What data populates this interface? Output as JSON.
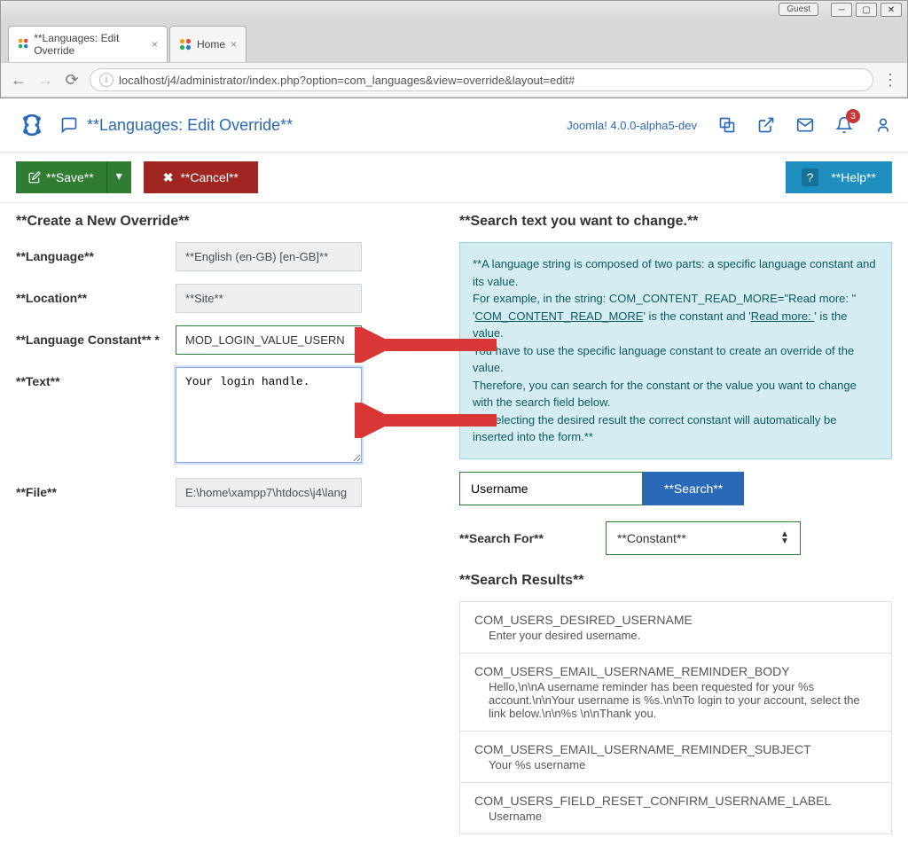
{
  "browser": {
    "guest": "Guest",
    "tabs": [
      {
        "title": "**Languages: Edit Override",
        "active": true
      },
      {
        "title": "Home",
        "active": false
      }
    ],
    "url": "localhost/j4/administrator/index.php?option=com_languages&view=override&layout=edit#"
  },
  "header": {
    "title": "**Languages: Edit Override**",
    "version": "Joomla! 4.0.0-alpha5-dev",
    "notification_count": "3"
  },
  "toolbar": {
    "save": "**Save**",
    "cancel": "**Cancel**",
    "help": "**Help**"
  },
  "form": {
    "heading": "**Create a New Override**",
    "language_label": "**Language**",
    "language_value": "**English (en-GB) [en-GB]**",
    "location_label": "**Location**",
    "location_value": "**Site**",
    "constant_label": "**Language Constant** *",
    "constant_value": "MOD_LOGIN_VALUE_USERN",
    "text_label": "**Text**",
    "text_value": "Your login handle.",
    "file_label": "**File**",
    "file_value": "E:\\home\\xampp7\\htdocs\\j4\\lang"
  },
  "search": {
    "heading": "**Search text you want to change.**",
    "info_p1": "**A language string is composed of two parts: a specific language constant and its value.",
    "info_p2a": "For example, in the string: COM_CONTENT_READ_MORE=\"Read more: \"",
    "info_link1": "COM_CONTENT_READ_MORE",
    "info_mid": "' is the constant and '",
    "info_link2": "Read more: ",
    "info_end": "' is the value.",
    "info_p3": "You have to use the specific language constant to create an override of the value.",
    "info_p4": "Therefore, you can search for the constant or the value you want to change with the search field below.",
    "info_p5": "By selecting the desired result the correct constant will automatically be inserted into the form.**",
    "input_value": "Username",
    "button": "**Search**",
    "for_label": "**Search For**",
    "for_value": "**Constant**",
    "results_heading": "**Search Results**",
    "results": [
      {
        "c": "COM_USERS_DESIRED_USERNAME",
        "v": "Enter your desired username."
      },
      {
        "c": "COM_USERS_EMAIL_USERNAME_REMINDER_BODY",
        "v": "Hello,\\n\\nA username reminder has been requested for your %s account.\\n\\nYour username is %s.\\n\\nTo login to your account, select the link below.\\n\\n%s \\n\\nThank you."
      },
      {
        "c": "COM_USERS_EMAIL_USERNAME_REMINDER_SUBJECT",
        "v": "Your %s username"
      },
      {
        "c": "COM_USERS_FIELD_RESET_CONFIRM_USERNAME_LABEL",
        "v": "Username"
      }
    ]
  }
}
